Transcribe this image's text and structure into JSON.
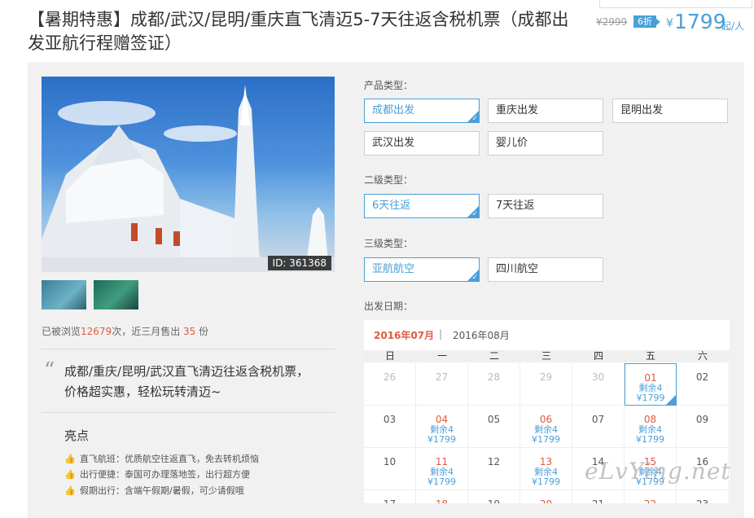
{
  "header": {
    "title": "【暑期特惠】成都/武汉/昆明/重庆直飞清迈5-7天往返含税机票（成都出发亚航行程赠签证）"
  },
  "price": {
    "original": "¥2999",
    "discount": "6折",
    "currency": "¥",
    "amount": "1799",
    "unit": "起/人",
    "accent_color": "#4a9fd8"
  },
  "gallery": {
    "image_id": "ID: 361368"
  },
  "stats": {
    "prefix": "已被浏览",
    "views": "12679",
    "middle": "次，近三月售出 ",
    "sold": "35",
    "suffix": " 份"
  },
  "summary": {
    "text": "成都/重庆/昆明/武汉直飞清迈往返含税机票，价格超实惠，轻松玩转清迈~"
  },
  "highlights": {
    "title": "亮点",
    "items": [
      "直飞航班：优质航空往返直飞，免去转机烦恼",
      "出行便捷：泰国可办理落地签，出行超方便",
      "假期出行：含端午假期/暑假，可少请假哦"
    ]
  },
  "options": {
    "product_label": "产品类型：",
    "product": [
      "成都出发",
      "重庆出发",
      "昆明出发",
      "武汉出发",
      "婴儿价"
    ],
    "level2_label": "二级类型：",
    "level2": [
      "6天往返",
      "7天往返"
    ],
    "level3_label": "三级类型：",
    "level3": [
      "亚航航空",
      "四川航空"
    ],
    "date_label": "出发日期："
  },
  "calendar": {
    "month_current": "2016年07月",
    "separator": "|",
    "month_next": "2016年08月",
    "weekdays": [
      "日",
      "一",
      "二",
      "三",
      "四",
      "五",
      "六"
    ],
    "remain_text": "剩余4",
    "price_text": "¥1799",
    "rows": [
      [
        {
          "d": "26",
          "s": "past"
        },
        {
          "d": "27",
          "s": "past"
        },
        {
          "d": "28",
          "s": "past"
        },
        {
          "d": "29",
          "s": "past"
        },
        {
          "d": "30",
          "s": "past"
        },
        {
          "d": "01",
          "s": "avail",
          "sel": true
        },
        {
          "d": "02",
          "s": "plain"
        }
      ],
      [
        {
          "d": "03",
          "s": "plain"
        },
        {
          "d": "04",
          "s": "avail"
        },
        {
          "d": "05",
          "s": "plain"
        },
        {
          "d": "06",
          "s": "avail"
        },
        {
          "d": "07",
          "s": "plain"
        },
        {
          "d": "08",
          "s": "avail"
        },
        {
          "d": "09",
          "s": "plain"
        }
      ],
      [
        {
          "d": "10",
          "s": "plain"
        },
        {
          "d": "11",
          "s": "avail"
        },
        {
          "d": "12",
          "s": "plain"
        },
        {
          "d": "13",
          "s": "avail"
        },
        {
          "d": "14",
          "s": "plain"
        },
        {
          "d": "15",
          "s": "avail"
        },
        {
          "d": "16",
          "s": "plain"
        }
      ],
      [
        {
          "d": "17",
          "s": "plain"
        },
        {
          "d": "18",
          "s": "avail"
        },
        {
          "d": "19",
          "s": "plain"
        },
        {
          "d": "20",
          "s": "avail"
        },
        {
          "d": "21",
          "s": "plain"
        },
        {
          "d": "22",
          "s": "avail"
        },
        {
          "d": "23",
          "s": "plain"
        }
      ]
    ]
  },
  "watermark": "eLvYing.net"
}
